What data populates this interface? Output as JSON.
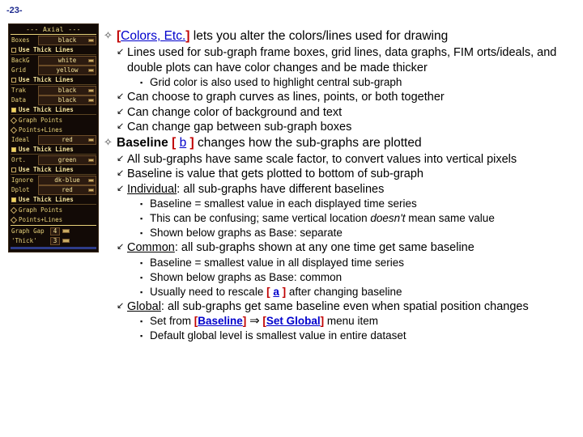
{
  "page_number": "-23-",
  "panel": {
    "title": "--- Axial ---",
    "rows": [
      {
        "kind": "option",
        "label": "Boxes",
        "value": "black"
      },
      {
        "kind": "check",
        "label": "Use Thick Lines",
        "checked": false
      },
      {
        "kind": "option",
        "label": "BackG",
        "value": "white"
      },
      {
        "kind": "option",
        "label": "Grid",
        "value": "yellow"
      },
      {
        "kind": "check",
        "label": "Use Thick Lines",
        "checked": false
      },
      {
        "kind": "option",
        "label": "Trak",
        "value": "black"
      },
      {
        "kind": "option",
        "label": "Data",
        "value": "black"
      },
      {
        "kind": "check",
        "label": "Use Thick Lines",
        "checked": true
      },
      {
        "kind": "radio",
        "label": "Graph Points",
        "selected": false
      },
      {
        "kind": "radio",
        "label": "Points+Lines",
        "selected": false
      },
      {
        "kind": "option",
        "label": "Ideal",
        "value": "red"
      },
      {
        "kind": "check",
        "label": "Use Thick Lines",
        "checked": true
      },
      {
        "kind": "option",
        "label": "Ort.",
        "value": "green"
      },
      {
        "kind": "check",
        "label": "Use Thick Lines",
        "checked": false
      },
      {
        "kind": "option",
        "label": "Ignore",
        "value": "dk-blue"
      },
      {
        "kind": "option",
        "label": "Dplot",
        "value": "red"
      },
      {
        "kind": "check",
        "label": "Use Thick Lines",
        "checked": true
      },
      {
        "kind": "radio",
        "label": "Graph Points",
        "selected": false
      },
      {
        "kind": "radio",
        "label": "Points+Lines",
        "selected": false
      }
    ],
    "spinners": [
      {
        "label": "Graph Gap",
        "value": "4"
      },
      {
        "label": "'Thick'",
        "value": "3"
      }
    ]
  },
  "colors": {
    "link": "#0000cc",
    "bracket": "#c00000",
    "page_number": "#1f2b8f",
    "panel_bg": "#120a06",
    "panel_text": "#f2e08a"
  },
  "bullets": {
    "level1": "✧",
    "level2": "↙",
    "level3": "▪"
  },
  "content": {
    "b1": {
      "link": "Colors, Etc.",
      "rest": " lets you alter the colors/lines used for drawing"
    },
    "b1_s1": "Lines used for sub-graph frame boxes, grid lines, data graphs, FIM orts/ideals, and double plots can have color changes and be made thicker",
    "b1_s1_t1": "Grid color is also used to highlight central sub-graph",
    "b1_s2": "Can choose to graph curves as lines, points, or both together",
    "b1_s3": "Can change color of background and text",
    "b1_s4": "Can change gap between sub-graph boxes",
    "b2": {
      "title": "Baseline",
      "key": "b",
      "rest": " changes how the sub-graphs are plotted"
    },
    "b2_s1": "All sub-graphs have same scale factor, to convert values into vertical pixels",
    "b2_s2": "Baseline is value that gets plotted to bottom of sub-graph",
    "b2_s3": {
      "term": "Individual",
      "rest": ": all sub-graphs have different baselines"
    },
    "b2_s3_t1": "Baseline = smallest value in each displayed time series",
    "b2_s3_t2": {
      "pre": "This can be confusing; same vertical location ",
      "em": "doesn't",
      "post": " mean same value"
    },
    "b2_s3_t3": "Shown below graphs as Base: separate",
    "b2_s4": {
      "term": "Common",
      "rest": ": all sub-graphs shown at any one time get same baseline"
    },
    "b2_s4_t1": "Baseline = smallest value in all displayed time series",
    "b2_s4_t2": "Shown below graphs as Base: common",
    "b2_s4_t3": {
      "pre": "Usually need to rescale ",
      "key": "a",
      "post": " after changing baseline"
    },
    "b2_s5": {
      "term": "Global",
      "rest": ": all sub-graphs get same baseline even when spatial position changes"
    },
    "b2_s5_t1": {
      "pre": "Set from ",
      "menu1": "Baseline",
      "arrow": "⇒",
      "menu2": "Set Global",
      "post": " menu item"
    },
    "b2_s5_t2": "Default global level is smallest value in entire dataset"
  }
}
